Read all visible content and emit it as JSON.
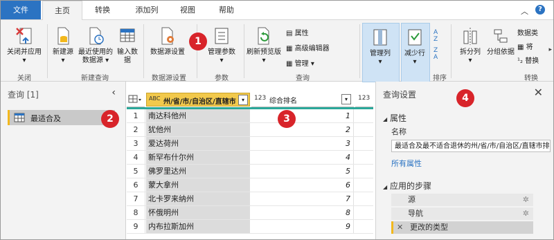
{
  "tabs": {
    "file": "文件",
    "home": "主页",
    "transform": "转换",
    "add_column": "添加列",
    "view": "视图",
    "help": "帮助"
  },
  "help_glyph": "?",
  "chevron_glyph": "︿",
  "ribbon": {
    "close_apply": "关闭并应用",
    "close_apply_arrow": "▾",
    "group_close": "关闭",
    "new_source": "新建源",
    "recent_sources": "最近使用的数据源",
    "enter_data": "输入数据",
    "group_new_query": "新建查询",
    "data_source_settings": "数据源设置",
    "group_data_sources": "数据源设置",
    "manage_params": "管理参数",
    "group_params": "参数",
    "refresh_preview": "刷新预览版",
    "properties": "属性",
    "advanced_editor": "高级编辑器",
    "manage": "管理",
    "group_query": "查询",
    "manage_columns": "管理列",
    "reduce_rows": "减少行",
    "group_sort": "排序",
    "split_column": "拆分列",
    "group_by": "分组依据",
    "data_type": "数据类",
    "replace1": "将",
    "replace2": "替换",
    "group_transform": "转换",
    "scroll_right": "▸"
  },
  "callouts": [
    "1",
    "2",
    "3",
    "4"
  ],
  "queries": {
    "header": "查询 [1]",
    "collapse": "‹",
    "item": "最适合及"
  },
  "grid": {
    "col1_header": "州/省/市/自治区/直辖市",
    "col1_type": "ABC",
    "col2_header": "综合排名",
    "col2_type": "123",
    "col3_type": "123",
    "rows": [
      {
        "idx": "1",
        "name": "南达科他州",
        "rank": "1"
      },
      {
        "idx": "2",
        "name": "犹他州",
        "rank": "2"
      },
      {
        "idx": "3",
        "name": "爱达荷州",
        "rank": "3"
      },
      {
        "idx": "4",
        "name": "新罕布什尔州",
        "rank": "4"
      },
      {
        "idx": "5",
        "name": "佛罗里达州",
        "rank": "5"
      },
      {
        "idx": "6",
        "name": "蒙大拿州",
        "rank": "6"
      },
      {
        "idx": "7",
        "name": "北卡罗来纳州",
        "rank": "7"
      },
      {
        "idx": "8",
        "name": "怀俄明州",
        "rank": "8"
      },
      {
        "idx": "9",
        "name": "内布拉斯加州",
        "rank": "9"
      }
    ]
  },
  "settings": {
    "title": "查询设置",
    "close": "✕",
    "properties": "属性",
    "name_label": "名称",
    "name_value": "最适合及最不适合退休的州/省/市/自治区/直辖市排名",
    "all_properties": "所有属性",
    "applied_steps": "应用的步骤",
    "steps": [
      "源",
      "导航",
      "更改的类型"
    ]
  },
  "colors": {
    "accent": "#2b73c2",
    "callout": "#d8242a",
    "query_marker": "#f2b81d",
    "column_header_hl": "#f2c94c"
  }
}
